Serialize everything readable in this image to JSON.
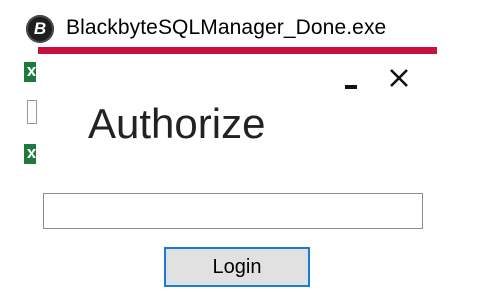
{
  "file": {
    "name": "BlackbyteSQLManager_Done.exe",
    "icon_letter": "B",
    "icon": "blackbyte-app-icon"
  },
  "side_icons": [
    "excel-file-icon",
    "document-file-icon",
    "excel-file-icon"
  ],
  "accent_color": "#c8103d",
  "dialog": {
    "title": "Authorize",
    "minimize_icon": "minimize-icon",
    "close_icon": "close-icon",
    "input_value": "",
    "login_label": "Login",
    "focus_color": "#1f7bd0"
  }
}
